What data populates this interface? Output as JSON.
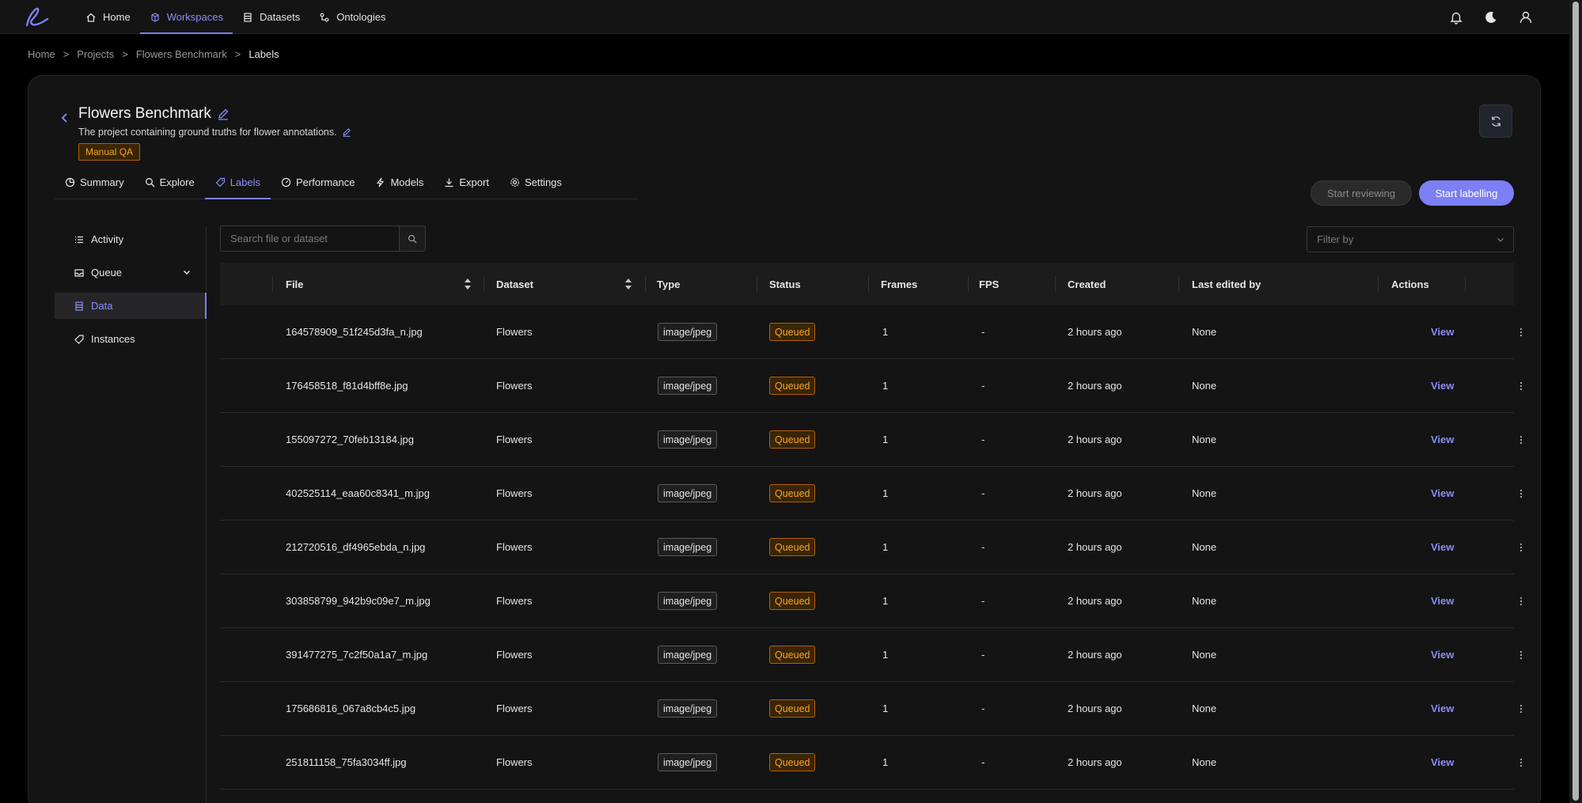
{
  "nav": {
    "items": [
      {
        "label": "Home",
        "icon": "home-icon"
      },
      {
        "label": "Workspaces",
        "icon": "cube-icon"
      },
      {
        "label": "Datasets",
        "icon": "database-icon"
      },
      {
        "label": "Ontologies",
        "icon": "nodes-icon"
      }
    ],
    "active": "Workspaces"
  },
  "breadcrumb": {
    "items": [
      "Home",
      "Projects",
      "Flowers Benchmark",
      "Labels"
    ],
    "separator": ">"
  },
  "project": {
    "title": "Flowers Benchmark",
    "description": "The project containing ground truths for flower annotations.",
    "badge": "Manual QA"
  },
  "tabs": [
    {
      "label": "Summary",
      "icon": "pie-chart-icon"
    },
    {
      "label": "Explore",
      "icon": "search-icon"
    },
    {
      "label": "Labels",
      "icon": "tag-icon"
    },
    {
      "label": "Performance",
      "icon": "gauge-icon"
    },
    {
      "label": "Models",
      "icon": "lightning-icon"
    },
    {
      "label": "Export",
      "icon": "download-icon"
    },
    {
      "label": "Settings",
      "icon": "gear-icon"
    }
  ],
  "actions": {
    "start_reviewing": "Start reviewing",
    "start_labelling": "Start labelling"
  },
  "sidemenu": [
    {
      "label": "Activity",
      "icon": "list-icon"
    },
    {
      "label": "Queue",
      "icon": "inbox-icon"
    },
    {
      "label": "Data",
      "icon": "database-icon"
    },
    {
      "label": "Instances",
      "icon": "tag-icon"
    }
  ],
  "search": {
    "placeholder": "Search file or dataset"
  },
  "filter": {
    "placeholder": "Filter by"
  },
  "table": {
    "columns": [
      "File",
      "Dataset",
      "Type",
      "Status",
      "Frames",
      "FPS",
      "Created",
      "Last edited by",
      "Actions"
    ],
    "action_label": "View",
    "rows": [
      {
        "file": "164578909_51f245d3fa_n.jpg",
        "dataset": "Flowers",
        "type": "image/jpeg",
        "status": "Queued",
        "frames": "1",
        "fps": "-",
        "created": "2 hours ago",
        "edited_by": "None"
      },
      {
        "file": "176458518_f81d4bff8e.jpg",
        "dataset": "Flowers",
        "type": "image/jpeg",
        "status": "Queued",
        "frames": "1",
        "fps": "-",
        "created": "2 hours ago",
        "edited_by": "None"
      },
      {
        "file": "155097272_70feb13184.jpg",
        "dataset": "Flowers",
        "type": "image/jpeg",
        "status": "Queued",
        "frames": "1",
        "fps": "-",
        "created": "2 hours ago",
        "edited_by": "None"
      },
      {
        "file": "402525114_eaa60c8341_m.jpg",
        "dataset": "Flowers",
        "type": "image/jpeg",
        "status": "Queued",
        "frames": "1",
        "fps": "-",
        "created": "2 hours ago",
        "edited_by": "None"
      },
      {
        "file": "212720516_df4965ebda_n.jpg",
        "dataset": "Flowers",
        "type": "image/jpeg",
        "status": "Queued",
        "frames": "1",
        "fps": "-",
        "created": "2 hours ago",
        "edited_by": "None"
      },
      {
        "file": "303858799_942b9c09e7_m.jpg",
        "dataset": "Flowers",
        "type": "image/jpeg",
        "status": "Queued",
        "frames": "1",
        "fps": "-",
        "created": "2 hours ago",
        "edited_by": "None"
      },
      {
        "file": "391477275_7c2f50a1a7_m.jpg",
        "dataset": "Flowers",
        "type": "image/jpeg",
        "status": "Queued",
        "frames": "1",
        "fps": "-",
        "created": "2 hours ago",
        "edited_by": "None"
      },
      {
        "file": "175686816_067a8cb4c5.jpg",
        "dataset": "Flowers",
        "type": "image/jpeg",
        "status": "Queued",
        "frames": "1",
        "fps": "-",
        "created": "2 hours ago",
        "edited_by": "None"
      },
      {
        "file": "251811158_75fa3034ff.jpg",
        "dataset": "Flowers",
        "type": "image/jpeg",
        "status": "Queued",
        "frames": "1",
        "fps": "-",
        "created": "2 hours ago",
        "edited_by": "None"
      }
    ]
  },
  "colors": {
    "accent": "#7c7ff5",
    "status_queued": "#f5a623",
    "background": "#141414"
  }
}
